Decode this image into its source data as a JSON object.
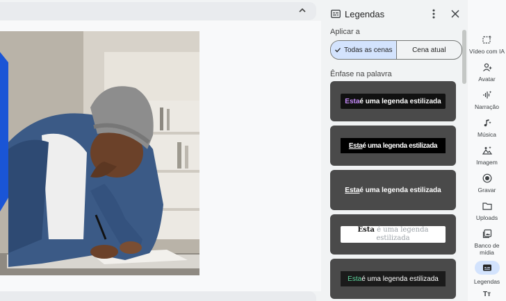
{
  "editor": {
    "collapse_icon": "chevron-up-icon"
  },
  "panel": {
    "title": "Legendas",
    "apply_label": "Aplicar a",
    "scope_options": [
      {
        "label": "Todas as cenas",
        "selected": true
      },
      {
        "label": "Cena atual",
        "selected": false
      }
    ],
    "section_label": "Ênfase na palavra",
    "styles": [
      {
        "highlight": "Esta",
        "rest": " é uma legenda estilizada"
      },
      {
        "highlight": "Esta",
        "rest": " é uma legenda estilizada"
      },
      {
        "highlight": "Esta",
        "rest": " é uma legenda estilizada"
      },
      {
        "highlight": "Esta",
        "rest": " é uma legenda estilizada"
      },
      {
        "highlight": "Esta",
        "rest": " é uma legenda estilizada"
      }
    ]
  },
  "rail": {
    "items": [
      {
        "label": "Vídeo com IA",
        "icon": "ai-video-icon"
      },
      {
        "label": "Avatar",
        "icon": "avatar-icon"
      },
      {
        "label": "Narração",
        "icon": "narration-icon"
      },
      {
        "label": "Música",
        "icon": "music-icon"
      },
      {
        "label": "Imagem",
        "icon": "image-icon"
      },
      {
        "label": "Gravar",
        "icon": "record-icon"
      },
      {
        "label": "Uploads",
        "icon": "folder-icon"
      },
      {
        "label": "Banco de mídia",
        "icon": "media-bank-icon"
      },
      {
        "label": "Legendas",
        "icon": "captions-icon",
        "active": true
      },
      {
        "label": "Tт",
        "icon": "text-icon"
      }
    ]
  },
  "colors": {
    "accent_pill": "#d3e3fd",
    "highlight_purple": "#c58af9",
    "highlight_green": "#5fd9a0"
  }
}
